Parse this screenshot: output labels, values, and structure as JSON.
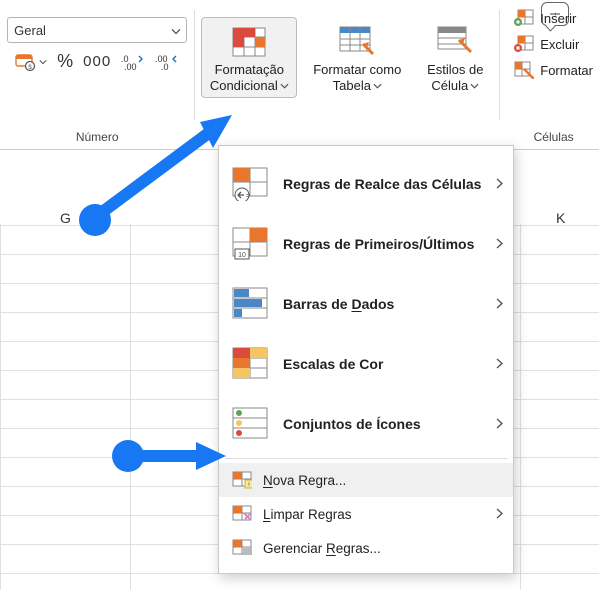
{
  "ribbon": {
    "number_group": {
      "label": "Número",
      "format_select": "Geral",
      "currency_btn": "currency",
      "percent_btn": "%",
      "thousands_btn": "000",
      "inc_dec_btn": "increase-decimal",
      "dec_dec_btn": "decrease-decimal"
    },
    "cond_fmt_btn": {
      "line1": "Formatação",
      "line2": "Condicional"
    },
    "fmt_table_btn": {
      "line1": "Formatar como",
      "line2": "Tabela"
    },
    "cell_styles_btn": {
      "line1": "Estilos de",
      "line2": "Célula"
    },
    "cells_group": {
      "label": "Células",
      "insert": "Inserir",
      "delete": "Excluir",
      "format": "Formatar"
    }
  },
  "dropdown": {
    "highlight": "Regras de Realce das Células",
    "toprules": "Regras de Primeiros/Últimos",
    "databars_pre": "Barras de ",
    "databars_u": "D",
    "databars_post": "ados",
    "colorscales": "Escalas de Cor",
    "iconsets": "Conjuntos de Ícones",
    "newrule_u": "N",
    "newrule_post": "ova Regra...",
    "clear_u": "L",
    "clear_post": "impar Regras",
    "manage_pre": "Gerenciar ",
    "manage_u": "R",
    "manage_post": "egras..."
  },
  "sheet": {
    "col_g": "G",
    "col_k": "K"
  },
  "colors": {
    "accent": "#1877F2",
    "orange": "#E8762D",
    "red": "#D94B3A",
    "green": "#5FA35B"
  }
}
